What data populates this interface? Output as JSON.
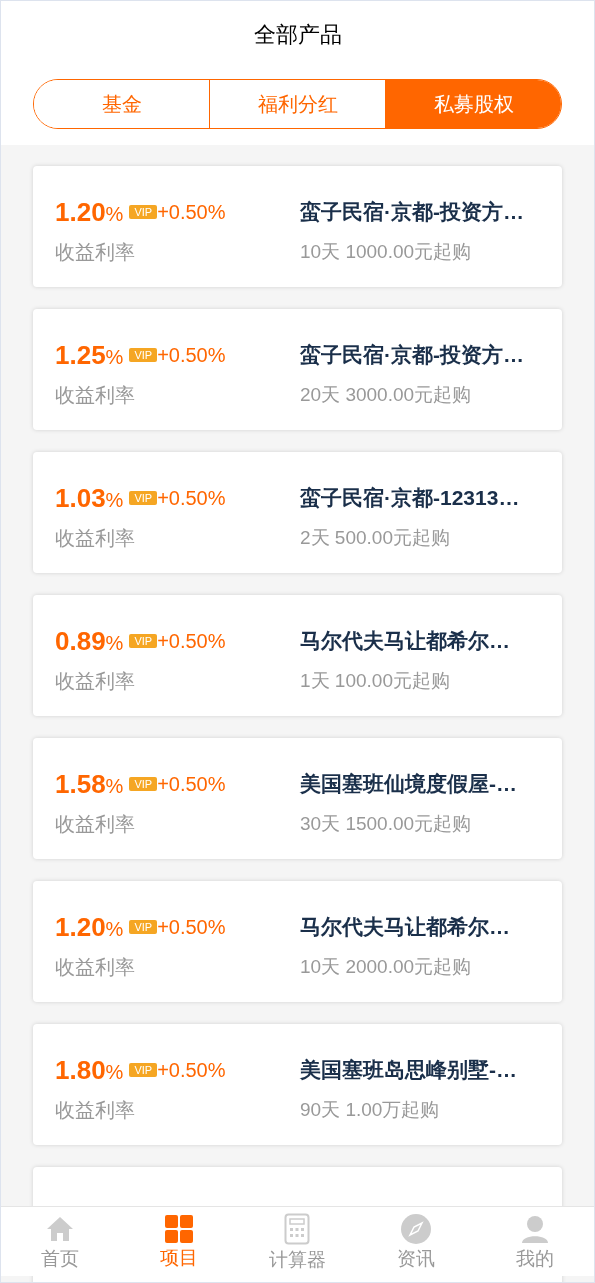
{
  "header": {
    "title": "全部产品"
  },
  "tabs": [
    {
      "label": "基金",
      "selected": false
    },
    {
      "label": "福利分红",
      "selected": false
    },
    {
      "label": "私募股权",
      "selected": true
    }
  ],
  "products": [
    {
      "rate": "1.20",
      "unit": "%",
      "badge": "VIP",
      "bonus": "+0.50%",
      "rate_label": "收益利率",
      "name": "蛮子民宿·京都-投资方…",
      "terms": "10天 1000.00元起购"
    },
    {
      "rate": "1.25",
      "unit": "%",
      "badge": "VIP",
      "bonus": "+0.50%",
      "rate_label": "收益利率",
      "name": "蛮子民宿·京都-投资方…",
      "terms": "20天 3000.00元起购"
    },
    {
      "rate": "1.03",
      "unit": "%",
      "badge": "VIP",
      "bonus": "+0.50%",
      "rate_label": "收益利率",
      "name": "蛮子民宿·京都-12313…",
      "terms": "2天 500.00元起购"
    },
    {
      "rate": "0.89",
      "unit": "%",
      "badge": "VIP",
      "bonus": "+0.50%",
      "rate_label": "收益利率",
      "name": "马尔代夫马让都希尔…",
      "terms": "1天 100.00元起购"
    },
    {
      "rate": "1.58",
      "unit": "%",
      "badge": "VIP",
      "bonus": "+0.50%",
      "rate_label": "收益利率",
      "name": "美国塞班仙境度假屋-…",
      "terms": "30天 1500.00元起购"
    },
    {
      "rate": "1.20",
      "unit": "%",
      "badge": "VIP",
      "bonus": "+0.50%",
      "rate_label": "收益利率",
      "name": "马尔代夫马让都希尔…",
      "terms": "10天 2000.00元起购"
    },
    {
      "rate": "1.80",
      "unit": "%",
      "badge": "VIP",
      "bonus": "+0.50%",
      "rate_label": "收益利率",
      "name": "美国塞班岛思峰别墅-…",
      "terms": "90天 1.00万起购"
    }
  ],
  "nav": [
    {
      "label": "首页",
      "kind": "home",
      "selected": false
    },
    {
      "label": "项目",
      "kind": "grid",
      "selected": true
    },
    {
      "label": "计算器",
      "kind": "calculator",
      "selected": false
    },
    {
      "label": "资讯",
      "kind": "compass",
      "selected": false
    },
    {
      "label": "我的",
      "kind": "user",
      "selected": false
    }
  ]
}
